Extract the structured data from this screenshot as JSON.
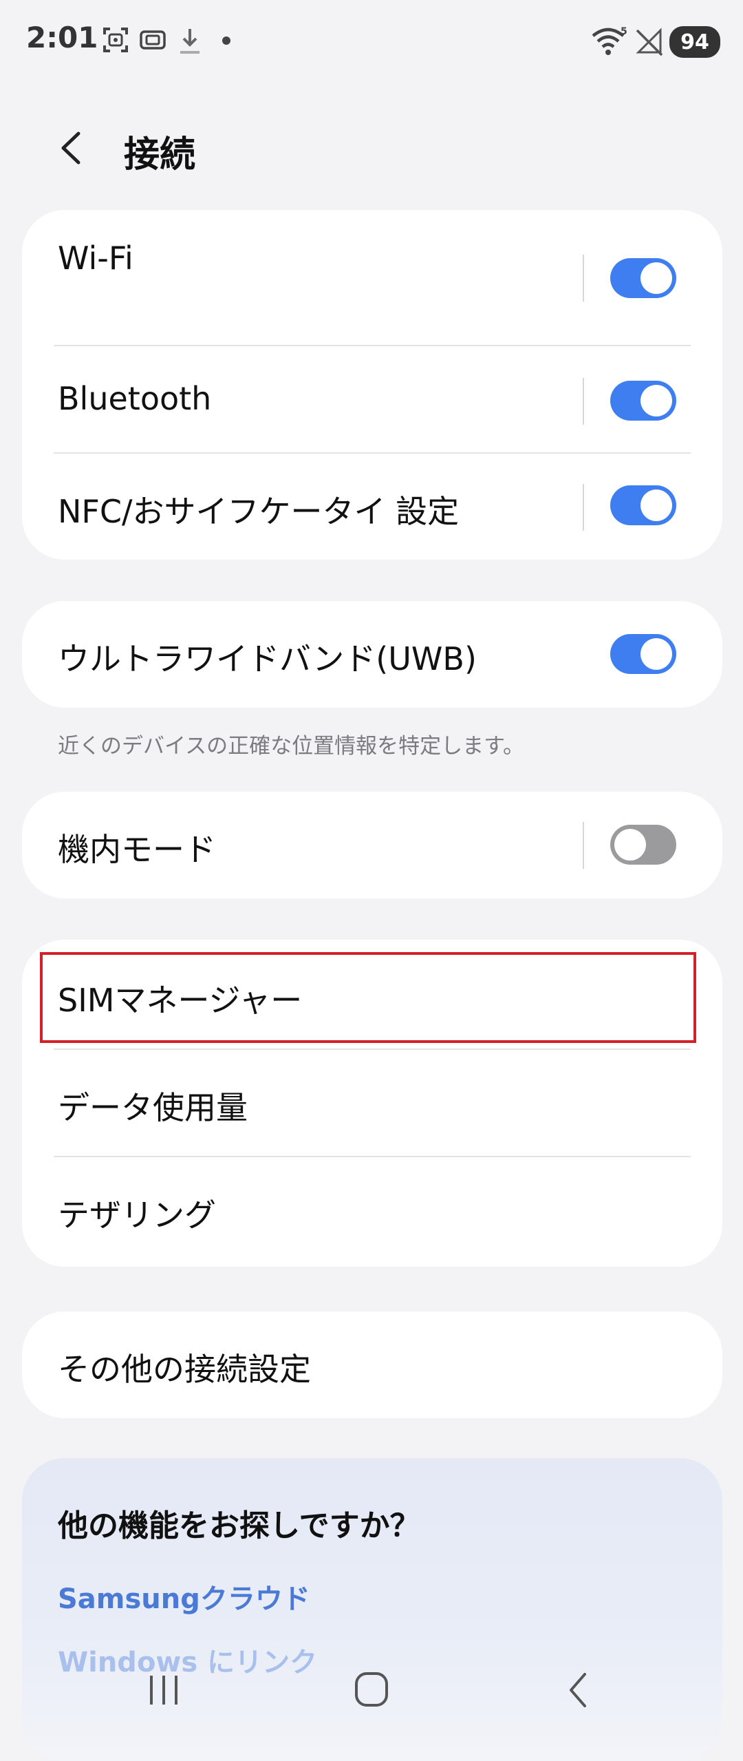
{
  "status_bar": {
    "time": "2:01",
    "battery": "94",
    "icons": [
      "screenshot-icon",
      "screen-record-icon",
      "download-icon",
      "notification-dot-icon",
      "wifi-icon",
      "no-signal-icon"
    ]
  },
  "header": {
    "title": "接続",
    "back_icon": "back-arrow-icon"
  },
  "group_wireless": {
    "items": [
      {
        "label": "Wi-Fi",
        "toggle": true
      },
      {
        "label": "Bluetooth",
        "toggle": true
      },
      {
        "label": "NFC/おサイフケータイ 設定",
        "toggle": true
      }
    ]
  },
  "group_uwb": {
    "label": "ウルトラワイドバンド(UWB)",
    "toggle": true,
    "description": "近くのデバイスの正確な位置情報を特定します。"
  },
  "group_airplane": {
    "label": "機内モード",
    "toggle": false
  },
  "group_network": {
    "items": [
      {
        "label": "SIMマネージャー"
      },
      {
        "label": "データ使用量"
      },
      {
        "label": "テザリング"
      }
    ]
  },
  "group_more": {
    "label": "その他の接続設定"
  },
  "suggestions": {
    "title": "他の機能をお探しですか？",
    "links": [
      "Samsungクラウド",
      "Windows にリンク"
    ]
  },
  "colors": {
    "toggle_on": "#3e7ef0",
    "toggle_off": "#9b9b9d",
    "link": "#4a79d6",
    "highlight": "#d3202a",
    "background": "#f3f3f5"
  },
  "nav_bar": {
    "icons": [
      "recent-apps-icon",
      "home-icon",
      "back-icon"
    ]
  }
}
